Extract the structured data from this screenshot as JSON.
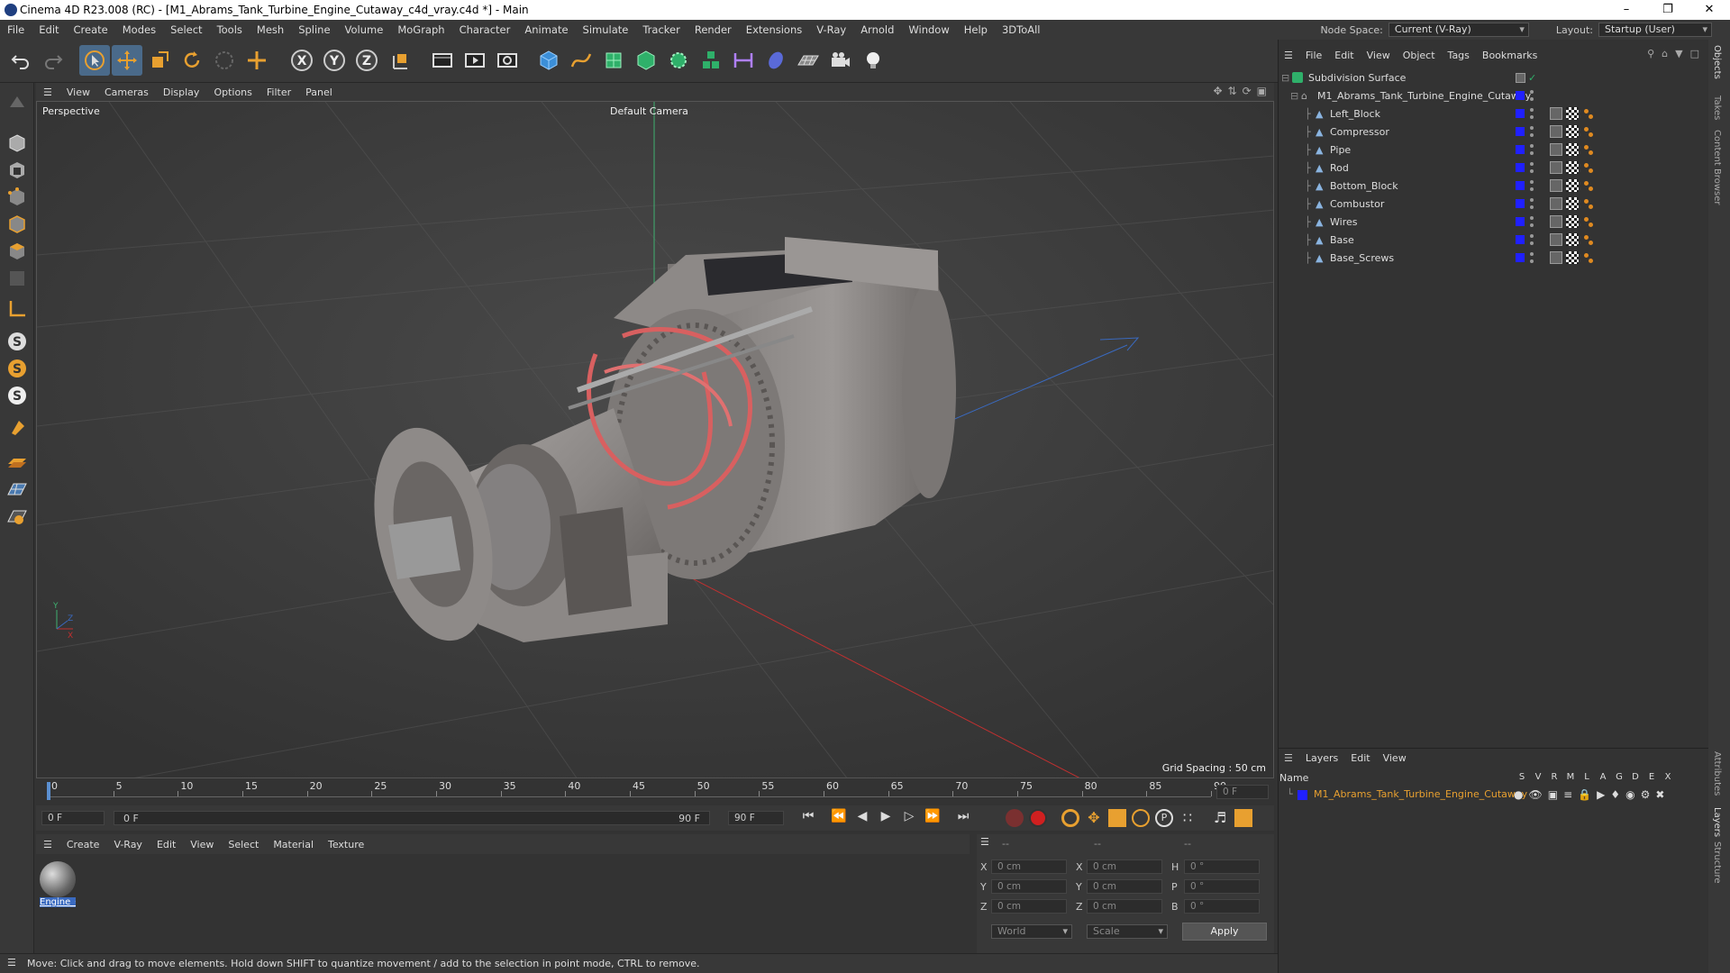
{
  "window": {
    "title": "Cinema 4D R23.008 (RC) - [M1_Abrams_Tank_Turbine_Engine_Cutaway_c4d_vray.c4d *] - Main"
  },
  "menubar": {
    "items": [
      "File",
      "Edit",
      "Create",
      "Modes",
      "Select",
      "Tools",
      "Mesh",
      "Spline",
      "Volume",
      "MoGraph",
      "Character",
      "Animate",
      "Simulate",
      "Tracker",
      "Render",
      "Extensions",
      "V-Ray",
      "Arnold",
      "Window",
      "Help",
      "3DToAll"
    ],
    "node_space_label": "Node Space:",
    "node_space_value": "Current (V-Ray)",
    "layout_label": "Layout:",
    "layout_value": "Startup (User)"
  },
  "viewport": {
    "menu": [
      "View",
      "Cameras",
      "Display",
      "Options",
      "Filter",
      "Panel"
    ],
    "label": "Perspective",
    "camera": "Default Camera",
    "grid_spacing": "Grid Spacing : 50 cm"
  },
  "timeline": {
    "ticks": [
      "0",
      "5",
      "10",
      "15",
      "20",
      "25",
      "30",
      "35",
      "40",
      "45",
      "50",
      "55",
      "60",
      "65",
      "70",
      "75",
      "80",
      "85",
      "90"
    ],
    "current_frame": "0 F"
  },
  "transport": {
    "start_field": "0 F",
    "range_start": "0 F",
    "range_end": "90 F",
    "end_field": "90 F"
  },
  "material_manager": {
    "menu": [
      "Create",
      "V-Ray",
      "Edit",
      "View",
      "Select",
      "Material",
      "Texture"
    ],
    "material_label": "Engine_C"
  },
  "attributes": {
    "header": [
      "--",
      "--",
      "--"
    ],
    "rows": [
      {
        "a": "X",
        "av": "0 cm",
        "b": "X",
        "bv": "0 cm",
        "c": "H",
        "cv": "0 °"
      },
      {
        "a": "Y",
        "av": "0 cm",
        "b": "Y",
        "bv": "0 cm",
        "c": "P",
        "cv": "0 °"
      },
      {
        "a": "Z",
        "av": "0 cm",
        "b": "Z",
        "bv": "0 cm",
        "c": "B",
        "cv": "0 °"
      }
    ],
    "coord_system": "World",
    "mode": "Scale",
    "apply": "Apply"
  },
  "status": "Move: Click and drag to move elements. Hold down SHIFT to quantize movement / add to the selection in point mode, CTRL to remove.",
  "object_manager": {
    "menu": [
      "File",
      "Edit",
      "View",
      "Object",
      "Tags",
      "Bookmarks"
    ],
    "root": "Subdivision Surface",
    "group": "M1_Abrams_Tank_Turbine_Engine_Cutaway",
    "children": [
      "Left_Block",
      "Compressor",
      "Pipe",
      "Rod",
      "Bottom_Block",
      "Combustor",
      "Wires",
      "Base",
      "Base_Screws"
    ]
  },
  "layers": {
    "menu": [
      "Layers",
      "Edit",
      "View"
    ],
    "name_header": "Name",
    "cols": [
      "S",
      "V",
      "R",
      "M",
      "L",
      "A",
      "G",
      "D",
      "E",
      "X"
    ],
    "layer_name": "M1_Abrams_Tank_Turbine_Engine_Cutaway"
  },
  "side_tabs": [
    "Objects",
    "Takes",
    "Content Browser",
    "Attributes",
    "Layers",
    "Structure"
  ]
}
